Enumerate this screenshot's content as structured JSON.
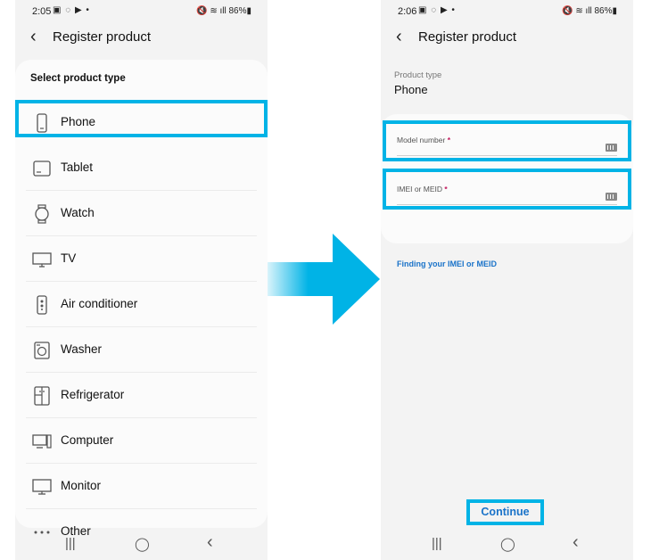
{
  "left_screen": {
    "status": {
      "time": "2:05",
      "notifications": "▣ ◌ ▶ •",
      "system": "🔇 ≋ ıll 86%▮"
    },
    "header": {
      "back_icon": "chevron-left",
      "title": "Register product"
    },
    "section_title": "Select product type",
    "items": [
      {
        "label": "Phone",
        "icon": "phone-icon"
      },
      {
        "label": "Tablet",
        "icon": "tablet-icon"
      },
      {
        "label": "Watch",
        "icon": "watch-icon"
      },
      {
        "label": "TV",
        "icon": "tv-icon"
      },
      {
        "label": "Air conditioner",
        "icon": "air-conditioner-icon"
      },
      {
        "label": "Washer",
        "icon": "washer-icon"
      },
      {
        "label": "Refrigerator",
        "icon": "refrigerator-icon"
      },
      {
        "label": "Computer",
        "icon": "computer-icon"
      },
      {
        "label": "Monitor",
        "icon": "monitor-icon"
      },
      {
        "label": "Other",
        "icon": "more-icon"
      }
    ],
    "navbar": {
      "recents": "|||",
      "home": "◯",
      "back": "‹"
    }
  },
  "right_screen": {
    "status": {
      "time": "2:06",
      "notifications": "▣ ◌ ▶ •",
      "system": "🔇 ≋ ıll 86%▮"
    },
    "header": {
      "back_icon": "chevron-left",
      "title": "Register product"
    },
    "product_type_label": "Product type",
    "product_type_value": "Phone",
    "fields": [
      {
        "label": "Model number",
        "required": "*"
      },
      {
        "label": "IMEI or MEID",
        "required": "*"
      }
    ],
    "help_link": "Finding your IMEI or MEID",
    "continue_label": "Continue",
    "navbar": {
      "recents": "|||",
      "home": "◯",
      "back": "‹"
    }
  },
  "colors": {
    "highlight": "#00b3e6",
    "link": "#1a73c9",
    "required": "#c2185b"
  }
}
